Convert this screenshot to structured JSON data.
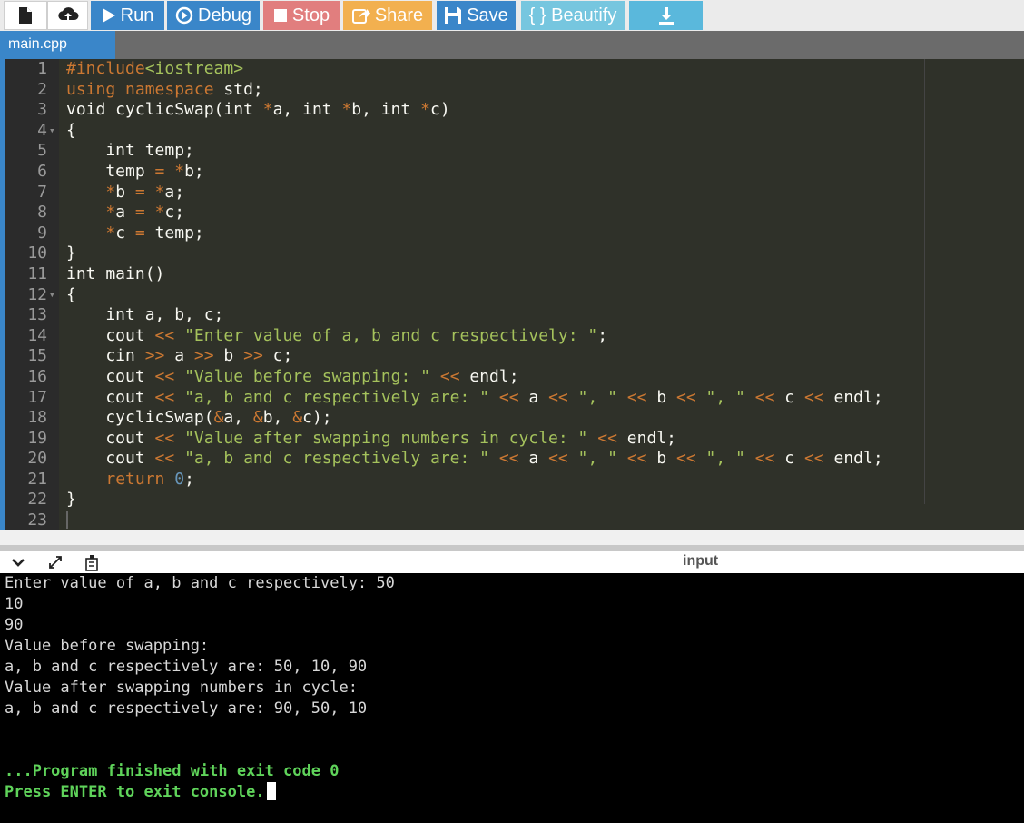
{
  "toolbar": {
    "new_icon": "new-file-icon",
    "upload_icon": "upload-icon",
    "run": "Run",
    "debug": "Debug",
    "stop": "Stop",
    "share": "Share",
    "save": "Save",
    "beautify": "{ } Beautify",
    "download_icon": "download-icon",
    "colors": {
      "run": "#3a86c9",
      "stop": "#e17e7e",
      "share": "#f2b04f",
      "beautify": "#76c6df"
    }
  },
  "file_tab": "main.cpp",
  "editor": {
    "line_numbers": [
      "1",
      "2",
      "3",
      "4",
      "5",
      "6",
      "7",
      "8",
      "9",
      "10",
      "11",
      "12",
      "13",
      "14",
      "15",
      "16",
      "17",
      "18",
      "19",
      "20",
      "21",
      "22",
      "23"
    ],
    "fold_markers": {
      "4": "▾",
      "12": "▾"
    }
  },
  "console_header": {
    "label": "input"
  },
  "console": {
    "lines": [
      "Enter value of a, b and c respectively: 50",
      "10",
      "90",
      "Value before swapping:",
      "a, b and c respectively are: 50, 10, 90",
      "Value after swapping numbers in cycle:",
      "a, b and c respectively are: 90, 50, 10"
    ],
    "finished": "...Program finished with exit code 0",
    "press_enter": "Press ENTER to exit console."
  }
}
